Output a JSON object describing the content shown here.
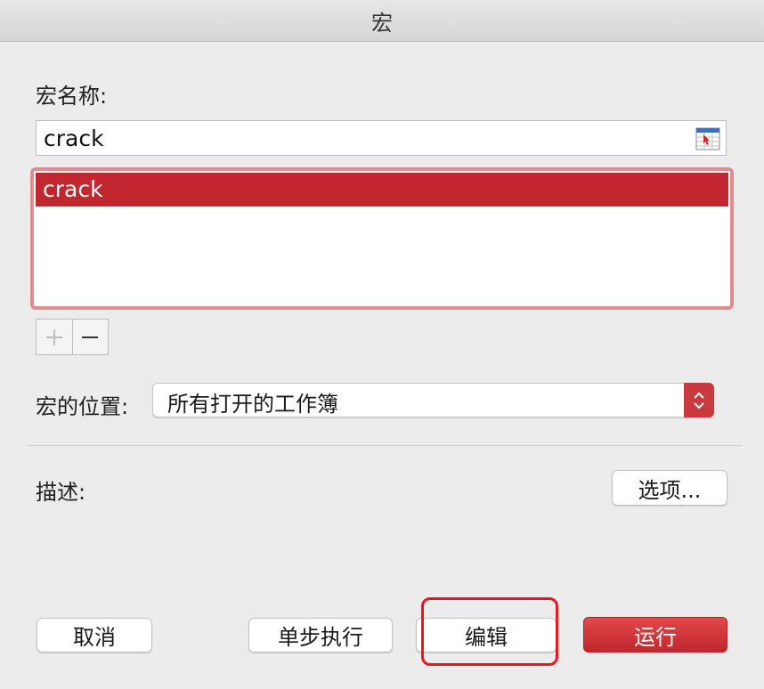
{
  "window": {
    "title": "宏"
  },
  "macro_name": {
    "label": "宏名称:",
    "value": "crack",
    "icon": "ref-select-icon"
  },
  "macro_list": {
    "items": [
      "crack"
    ],
    "selected_index": 0
  },
  "list_controls": {
    "add_icon": "plus-icon",
    "remove_icon": "minus-icon"
  },
  "location": {
    "label": "宏的位置:",
    "value": "所有打开的工作簿",
    "icon": "up-down-arrows-icon"
  },
  "description": {
    "label": "描述:"
  },
  "buttons": {
    "options": "选项...",
    "cancel": "取消",
    "step": "单步执行",
    "edit": "编辑",
    "run": "运行"
  },
  "colors": {
    "accent": "#c1272d",
    "focus_ring": "#e08b90",
    "highlight_box": "#f0121f"
  }
}
